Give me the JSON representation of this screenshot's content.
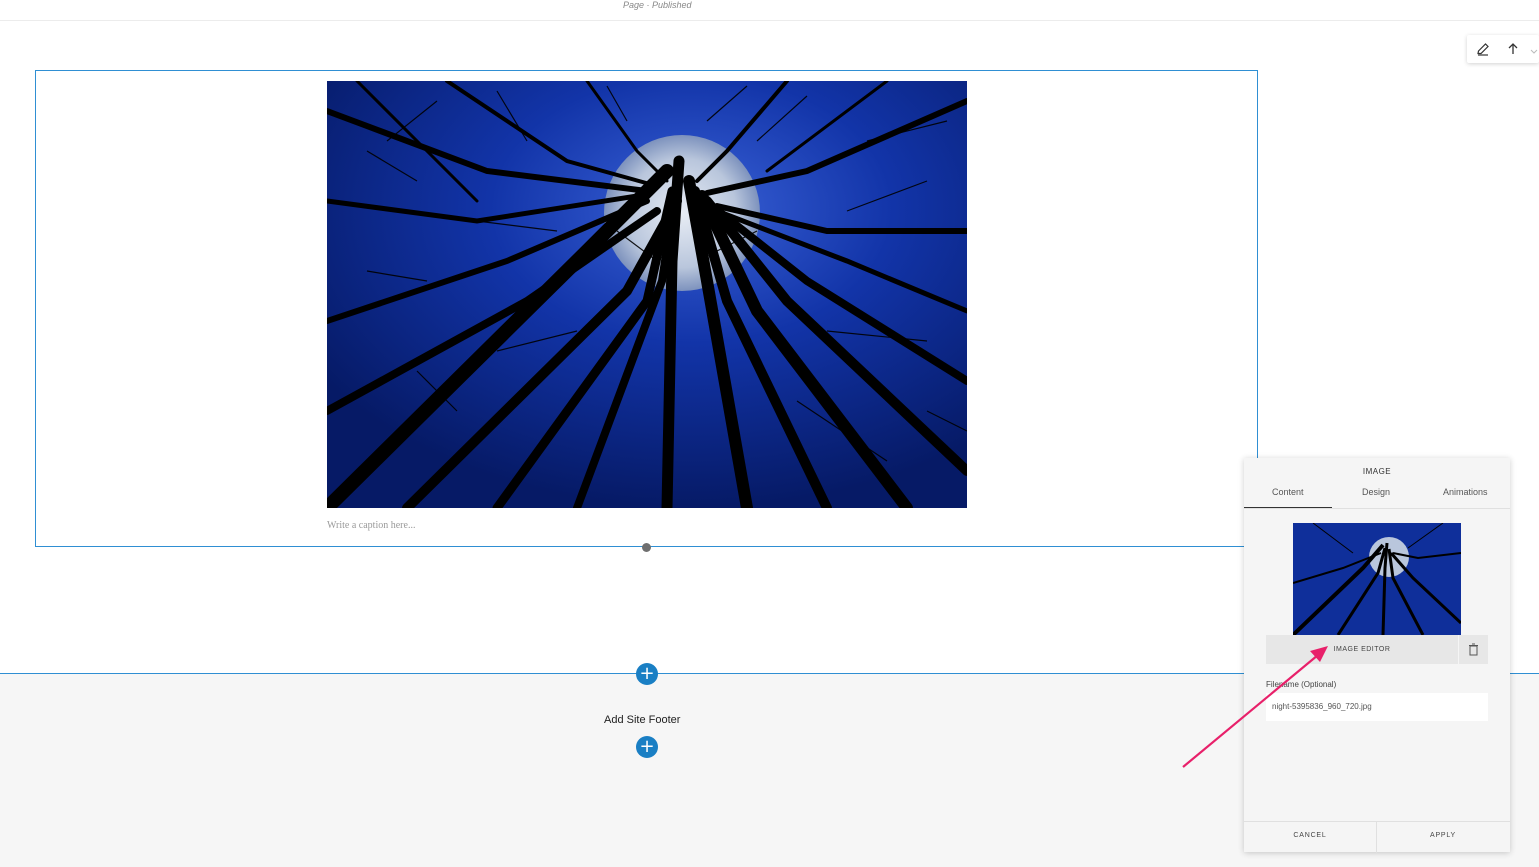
{
  "topbar": {
    "status": "Page · Published"
  },
  "toolbar": {
    "edit_icon": "pencil-icon",
    "move_icon": "arrow-up-icon"
  },
  "section": {
    "image_alt": "Night forest looking up at full moon",
    "caption_placeholder": "Write a caption here..."
  },
  "footer": {
    "add_label": "Add Site Footer",
    "plus_symbol": "+"
  },
  "panel": {
    "title": "IMAGE",
    "tabs": [
      {
        "label": "Content"
      },
      {
        "label": "Design"
      },
      {
        "label": "Animations"
      }
    ],
    "editor_button": "IMAGE EDITOR",
    "filename_label": "Filename (Optional)",
    "filename_value": "night-5395836_960_720.jpg",
    "cancel": "CANCEL",
    "apply": "APPLY"
  },
  "colors": {
    "accent": "#1a7fc4",
    "outline": "#2f8fd3",
    "annotation_arrow": "#e8206a",
    "night_sky": "#0f2f9a"
  }
}
